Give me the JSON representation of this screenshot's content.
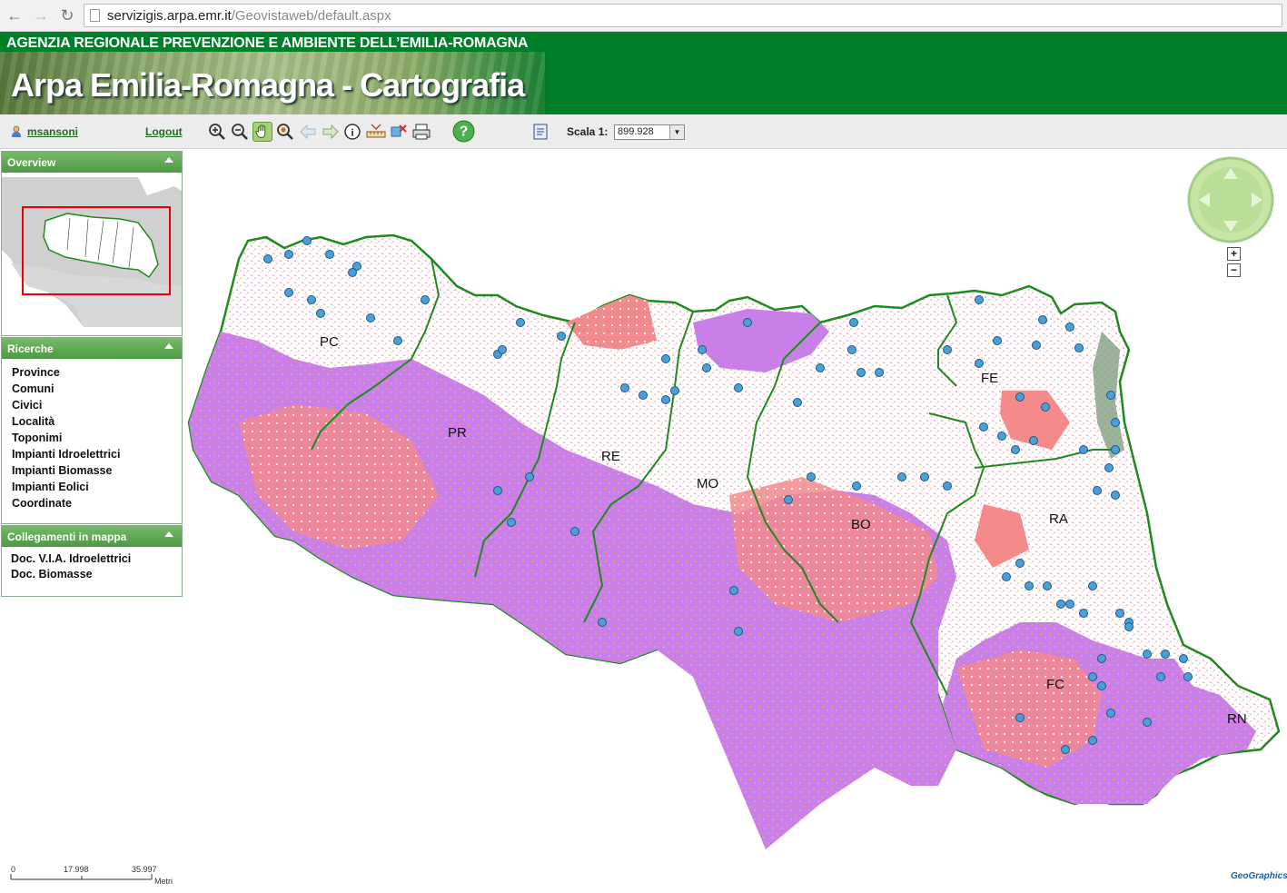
{
  "browser": {
    "url_host": "servizigis.arpa.emr.it",
    "url_path": "/Geovistaweb/default.aspx"
  },
  "banner": {
    "agency": "AGENZIA REGIONALE PREVENZIONE E AMBIENTE DELL’EMILIA-ROMAGNA",
    "title": "Arpa Emilia-Romagna - Cartografia"
  },
  "toolbar": {
    "username": "msansoni",
    "logout_label": "Logout",
    "scale_label": "Scala 1:",
    "scale_value": "899.928",
    "tools": [
      "zoom-in-icon",
      "zoom-out-icon",
      "pan-hand-icon",
      "zoom-window-icon",
      "back-arrow-icon",
      "forward-arrow-icon",
      "info-icon",
      "measure-icon",
      "clear-selection-icon",
      "print-icon",
      "help-icon",
      "legend-icon"
    ]
  },
  "panels": {
    "overview": {
      "title": "Overview"
    },
    "ricerche": {
      "title": "Ricerche",
      "items": [
        "Province",
        "Comuni",
        "Civici",
        "Località",
        "Toponimi",
        "Impianti Idroelettrici",
        "Impianti Biomasse",
        "Impianti Eolici",
        "Coordinate"
      ]
    },
    "collegamenti": {
      "title": "Collegamenti in mappa",
      "items": [
        "Doc. V.I.A. Idroelettrici",
        "Doc. Biomasse"
      ]
    }
  },
  "map": {
    "provinces": [
      "PC",
      "PR",
      "RE",
      "MO",
      "BO",
      "FE",
      "RA",
      "FC",
      "RN"
    ],
    "colors": {
      "boundary": "#1f8a1f",
      "violet": "#c97fe8",
      "salmon": "#f48a8a",
      "grey": "#7a9a7a",
      "point": "#4a9fd8"
    },
    "zoom_in": "+",
    "zoom_out": "−"
  },
  "scalebar": {
    "ticks": [
      "0",
      "17.998",
      "35.997"
    ],
    "unit": "Metri"
  },
  "footer": {
    "logo": "GeoGraphics"
  }
}
